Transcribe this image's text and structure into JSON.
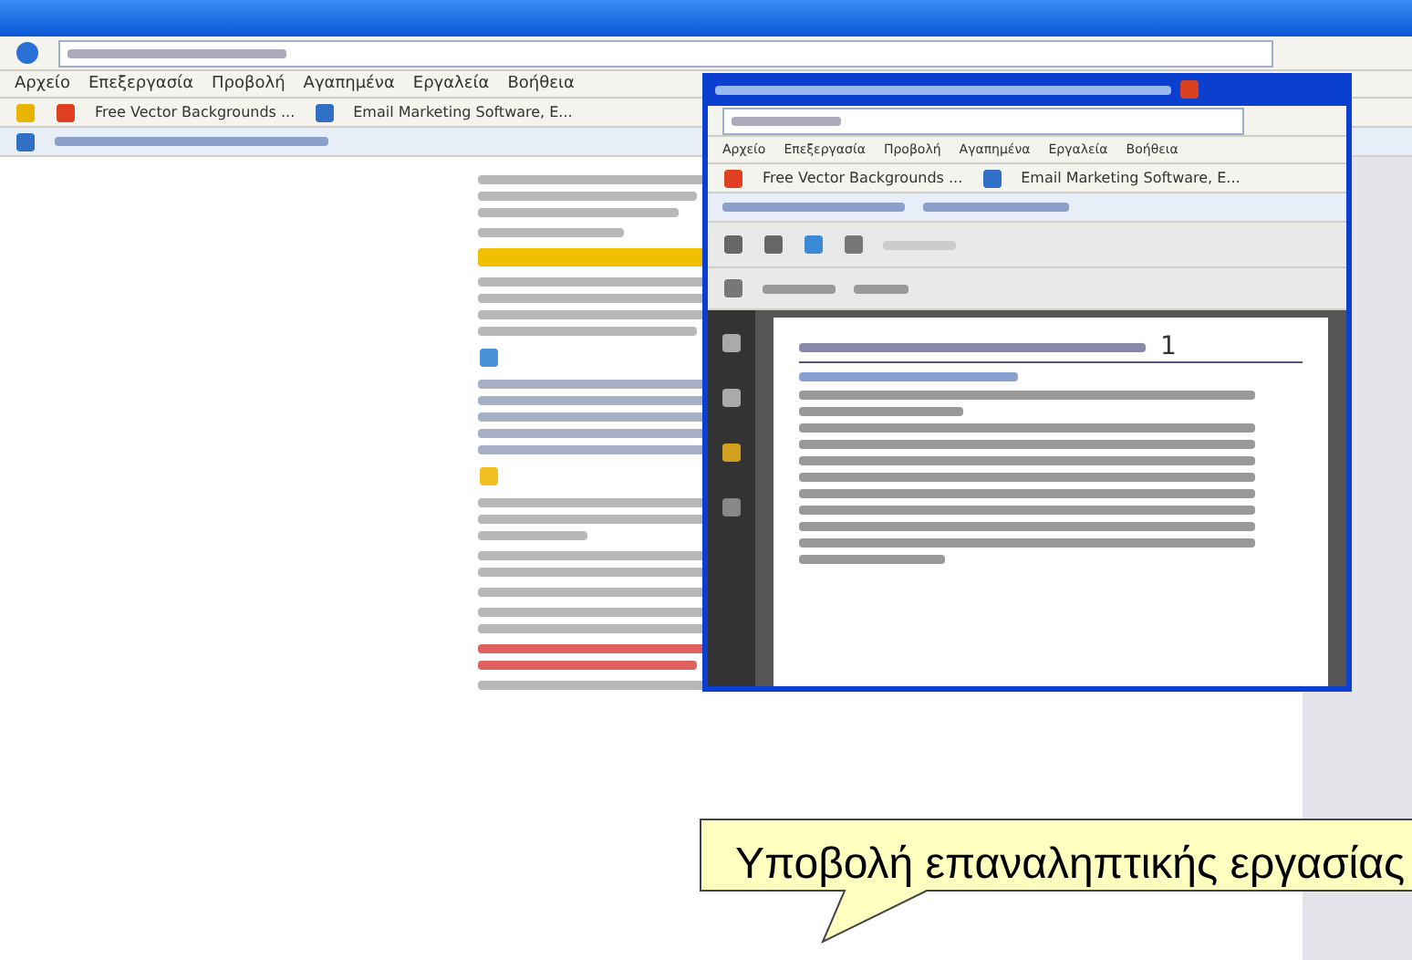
{
  "browser": {
    "menu": [
      "Αρχείο",
      "Επεξεργασία",
      "Προβολή",
      "Αγαπημένα",
      "Εργαλεία",
      "Βοήθεια"
    ],
    "favorites": [
      "Free Vector Backgrounds ...",
      "Email Marketing Software, E..."
    ]
  },
  "popup": {
    "menu": [
      "Αρχείο",
      "Επεξεργασία",
      "Προβολή",
      "Αγαπημένα",
      "Εργαλεία",
      "Βοήθεια"
    ],
    "favorites": [
      "Free Vector Backgrounds ...",
      "Email Marketing Software, E..."
    ],
    "page_number": "1"
  },
  "callout": {
    "text": "Υποβολή επαναληπτικής εργασίας"
  }
}
